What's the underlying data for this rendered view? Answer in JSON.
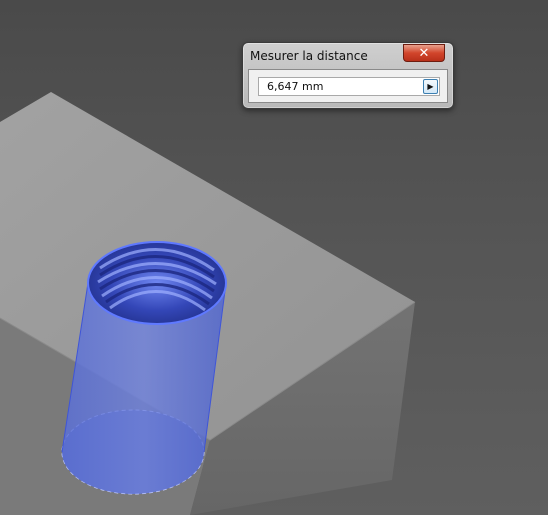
{
  "dialog": {
    "title": "Mesurer la distance",
    "close_icon": "close-icon",
    "value": "6,647 mm",
    "expand_icon": "arrow-right-icon"
  },
  "colors": {
    "background": "#555555",
    "block_top": "#9a9a9a",
    "block_side": "#6e6e6e",
    "hole_highlight": "#4a63e0",
    "close_button": "#d2452b"
  }
}
